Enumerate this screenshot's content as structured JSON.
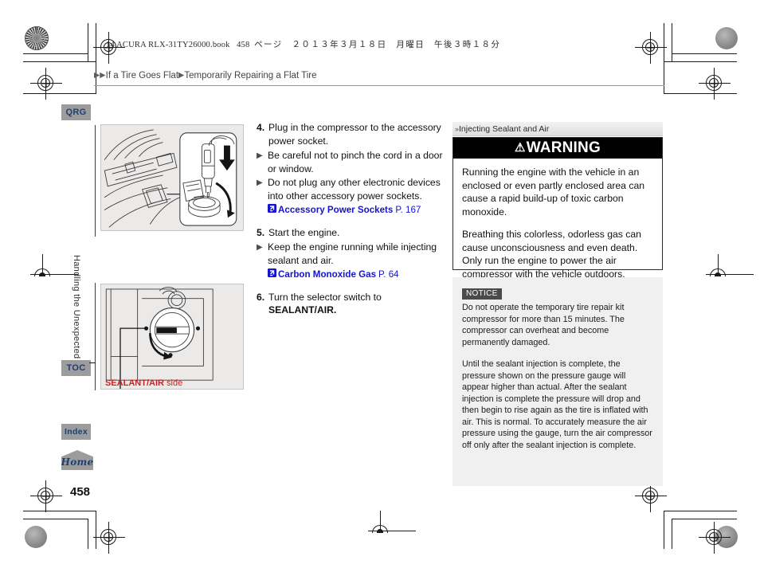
{
  "print_marks": {
    "book_line_prefix": "14 ACURA RLX-31TY26000.book",
    "book_line_page": "458",
    "book_line_jp": "ページ　２０１３年３月１８日　月曜日　午後３時１８分"
  },
  "breadcrumb": {
    "arrow_glyph": "▶▶",
    "level1": "If a Tire Goes Flat",
    "separator_glyph": "▶",
    "level2": "Temporarily Repairing a Flat Tire"
  },
  "sidebar": {
    "tabs": [
      {
        "id": "qrg",
        "label": "QRG"
      },
      {
        "id": "toc",
        "label": "TOC"
      },
      {
        "id": "index",
        "label": "Index"
      },
      {
        "id": "home",
        "label": "Home"
      }
    ],
    "chapter_title": "Handling the Unexpected"
  },
  "page_number": "458",
  "figures": {
    "socket": {
      "name": "accessory-power-socket-illustration"
    },
    "switch": {
      "name": "selector-switch-illustration"
    },
    "switch_caption_bold": "SEALANT/AIR",
    "switch_caption_rest": " side"
  },
  "steps": [
    {
      "number": "4.",
      "text": "Plug in the compressor to the accessory power socket.",
      "bullets": [
        "Be careful not to pinch the cord in a door or window.",
        "Do not plug any other electronic devices into other accessory power sockets."
      ],
      "xref": {
        "label": "Accessory Power Sockets",
        "page": "P. 167"
      }
    },
    {
      "number": "5.",
      "text": "Start the engine.",
      "bullets": [
        "Keep the engine running while injecting sealant and air."
      ],
      "xref": {
        "label": "Carbon Monoxide Gas",
        "page": "P. 64"
      }
    },
    {
      "number": "6.",
      "text_prefix": "Turn the selector switch to ",
      "text_bold": "SEALANT/AIR."
    }
  ],
  "side_panel": {
    "header": "Injecting Sealant and Air",
    "header_chevron": "»",
    "warning": {
      "title": "WARNING",
      "triangle_glyph": "⚠",
      "paragraphs": [
        "Running the engine with the vehicle in an enclosed or even partly enclosed area can cause a rapid build-up of toxic carbon monoxide.",
        "Breathing this colorless, odorless gas can cause unconsciousness and even death. Only run the engine to power the air compressor with the vehicle outdoors."
      ]
    },
    "notice": {
      "tag": "NOTICE",
      "paragraphs": [
        "Do not operate the temporary tire repair kit compressor for more than 15 minutes. The compressor can overheat and become permanently damaged.",
        "Until the sealant injection is complete, the pressure shown on the pressure gauge will appear higher than actual. After the sealant injection is complete the pressure will drop and then begin to rise again as the tire is inflated with air. This is normal. To accurately measure the air pressure using the gauge, turn the air compressor off only after the sealant injection is complete."
      ]
    }
  },
  "colors": {
    "link_blue": "#1414cf",
    "caption_red": "#d21f1f",
    "tab_gray": "#9c9c9c",
    "tab_text_navy": "#1d3f73",
    "warning_black": "#000000",
    "notice_gray": "#4a4a4a"
  }
}
